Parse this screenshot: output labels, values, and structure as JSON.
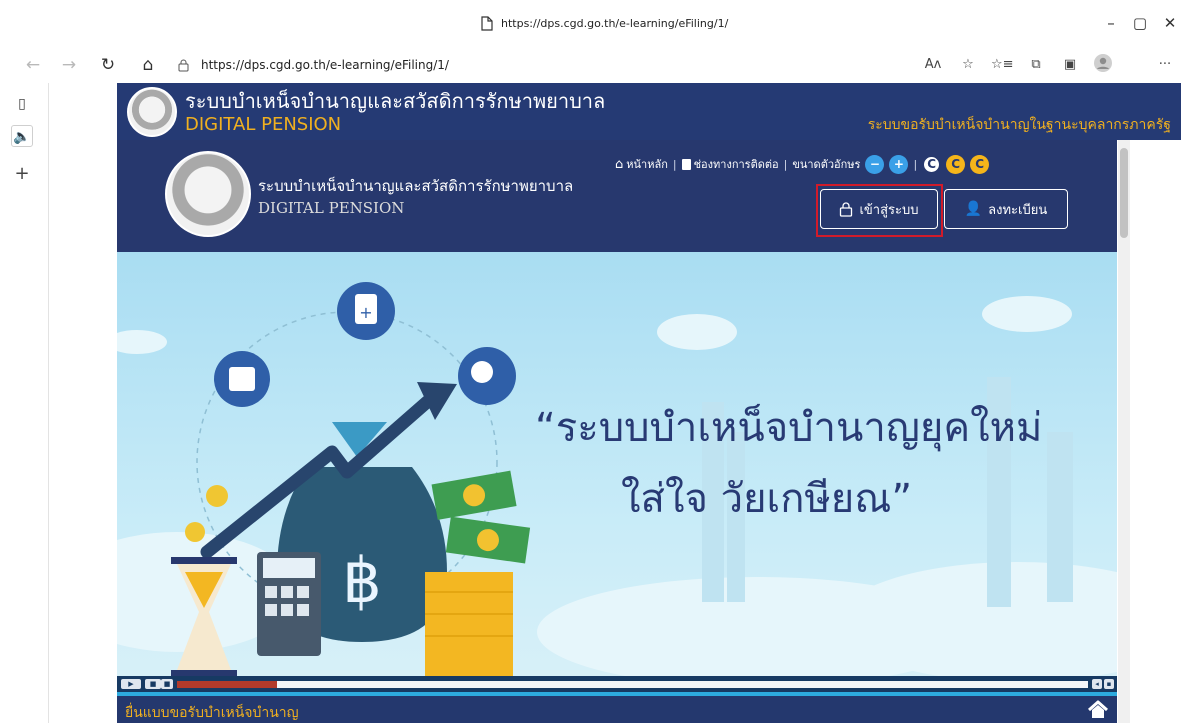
{
  "browser": {
    "tab_url": "https://dps.cgd.go.th/e-learning/eFiling/1/",
    "address_url": "https://dps.cgd.go.th/e-learning/eFiling/1/",
    "nav_icons": [
      "back-icon",
      "forward-icon",
      "reload-icon",
      "home-icon"
    ],
    "toolbar_icons": [
      "read-aloud-icon",
      "favorite-add-icon",
      "favorites-icon",
      "collections-icon",
      "extensions-icon",
      "profile-icon",
      "more-icon"
    ],
    "window_buttons": [
      "minimize-icon",
      "restore-icon",
      "close-icon"
    ],
    "side_panel_icons": [
      "tab-actions-icon",
      "speaker-icon",
      "add-icon"
    ]
  },
  "site": {
    "header_title_th": "ระบบบำเหน็จบำนาญและสวัสดิการรักษาพยาบาล",
    "header_title_en": "DIGITAL PENSION",
    "header_right": "ระบบขอรับบำเหน็จบำนาญในฐานะบุคลากรภาครัฐ",
    "logo_title_th": "ระบบบำเหน็จบำนาญและสวัสดิการรักษาพยาบาล",
    "logo_title_en": "DIGITAL PENSION",
    "util": {
      "home": "หน้าหลัก",
      "contact": "ช่องทางการติดต่อ",
      "font_size": "ขนาดตัวอักษร",
      "contrast": [
        "C",
        "C",
        "C"
      ]
    },
    "login": "เข้าสู่ระบบ",
    "register": "ลงทะเบียน",
    "hero_line1": "“ระบบบำเหน็จบำนาญยุคใหม่",
    "hero_line2": "ใส่ใจ วัยเกษียณ”",
    "footer": "ยื่นแบบขอรับบำเหน็จบำนาญ"
  },
  "colors": {
    "navy": "#27386e",
    "gold": "#f0b020",
    "highlight": "#d11b2a"
  }
}
